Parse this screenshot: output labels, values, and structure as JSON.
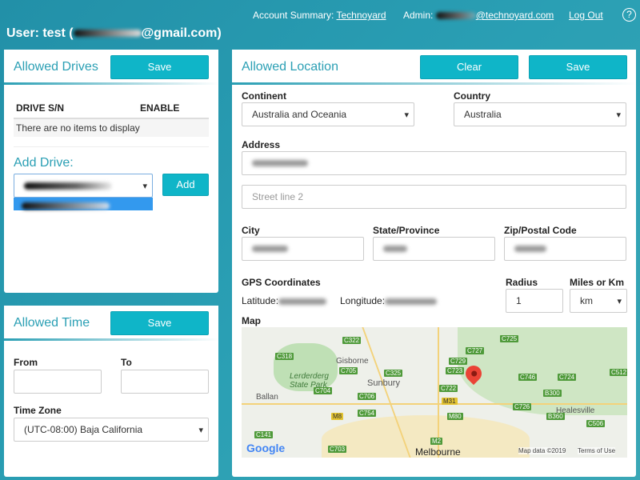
{
  "header": {
    "account_summary_label": "Account Summary:",
    "account_name": "Technoyard",
    "admin_label": "Admin:",
    "admin_email_suffix": "@technoyard.com",
    "logout": "Log Out",
    "help_icon": "question-circle-icon",
    "user_prefix": "User: test (",
    "user_email_suffix": "@gmail.com)"
  },
  "drives": {
    "title": "Allowed Drives",
    "save": "Save",
    "columns": [
      "DRIVE S/N",
      "ENABLE"
    ],
    "empty": "There are no items to display",
    "add_label": "Add Drive:",
    "add_button": "Add"
  },
  "time": {
    "title": "Allowed Time",
    "save": "Save",
    "from_label": "From",
    "from_value": "",
    "to_label": "To",
    "to_value": "",
    "timezone_label": "Time Zone",
    "timezone_value": "(UTC-08:00) Baja California"
  },
  "location": {
    "title": "Allowed Location",
    "clear": "Clear",
    "save": "Save",
    "continent_label": "Continent",
    "continent_value": "Australia and Oceania",
    "country_label": "Country",
    "country_value": "Australia",
    "address_label": "Address",
    "street2_placeholder": "Street line 2",
    "city_label": "City",
    "state_label": "State/Province",
    "zip_label": "Zip/Postal Code",
    "gps_label": "GPS Coordinates",
    "latitude_label": "Latitude:",
    "longitude_label": "Longitude:",
    "radius_label": "Radius",
    "radius_value": "1",
    "unit_label": "Miles or Km",
    "unit_value": "km",
    "map_label": "Map"
  },
  "map": {
    "towns": [
      "Gisborne",
      "Lerderderg State Park",
      "Sunbury",
      "Ballan",
      "Healesville",
      "Melbourne"
    ],
    "roads": [
      "C322",
      "C318",
      "C705",
      "C325",
      "C704",
      "C706",
      "C754",
      "C729",
      "C723",
      "C722",
      "C727",
      "C725",
      "C746",
      "C724",
      "B300",
      "C726",
      "B360",
      "C506",
      "M31",
      "M80",
      "M8",
      "C141",
      "M2",
      "C512",
      "C703"
    ],
    "footer": "Map data ©2019",
    "terms": "Terms of Use",
    "logo": "Google",
    "accent": "#ea4335"
  },
  "colors": {
    "accent": "#0fb5c8",
    "title": "#2a9fb4"
  }
}
